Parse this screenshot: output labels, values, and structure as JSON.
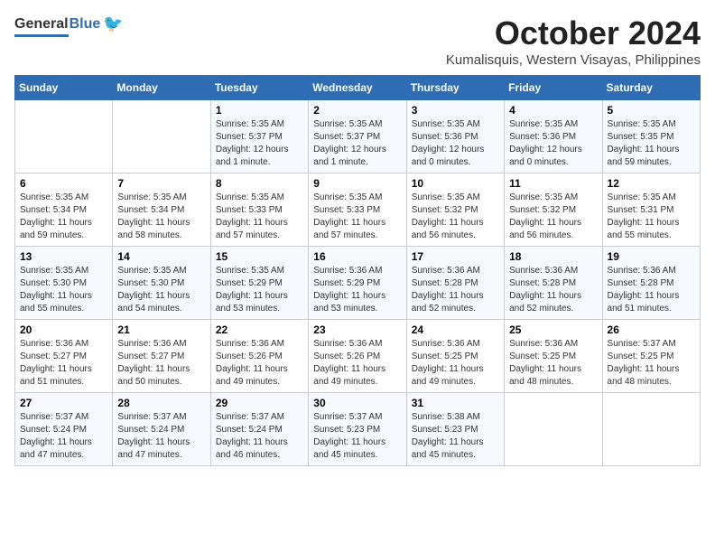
{
  "logo": {
    "general": "General",
    "blue": "Blue"
  },
  "title": {
    "month": "October 2024",
    "location": "Kumalisquis, Western Visayas, Philippines"
  },
  "headers": [
    "Sunday",
    "Monday",
    "Tuesday",
    "Wednesday",
    "Thursday",
    "Friday",
    "Saturday"
  ],
  "weeks": [
    [
      {
        "day": "",
        "sunrise": "",
        "sunset": "",
        "daylight": ""
      },
      {
        "day": "",
        "sunrise": "",
        "sunset": "",
        "daylight": ""
      },
      {
        "day": "1",
        "sunrise": "Sunrise: 5:35 AM",
        "sunset": "Sunset: 5:37 PM",
        "daylight": "Daylight: 12 hours and 1 minute."
      },
      {
        "day": "2",
        "sunrise": "Sunrise: 5:35 AM",
        "sunset": "Sunset: 5:37 PM",
        "daylight": "Daylight: 12 hours and 1 minute."
      },
      {
        "day": "3",
        "sunrise": "Sunrise: 5:35 AM",
        "sunset": "Sunset: 5:36 PM",
        "daylight": "Daylight: 12 hours and 0 minutes."
      },
      {
        "day": "4",
        "sunrise": "Sunrise: 5:35 AM",
        "sunset": "Sunset: 5:36 PM",
        "daylight": "Daylight: 12 hours and 0 minutes."
      },
      {
        "day": "5",
        "sunrise": "Sunrise: 5:35 AM",
        "sunset": "Sunset: 5:35 PM",
        "daylight": "Daylight: 11 hours and 59 minutes."
      }
    ],
    [
      {
        "day": "6",
        "sunrise": "Sunrise: 5:35 AM",
        "sunset": "Sunset: 5:34 PM",
        "daylight": "Daylight: 11 hours and 59 minutes."
      },
      {
        "day": "7",
        "sunrise": "Sunrise: 5:35 AM",
        "sunset": "Sunset: 5:34 PM",
        "daylight": "Daylight: 11 hours and 58 minutes."
      },
      {
        "day": "8",
        "sunrise": "Sunrise: 5:35 AM",
        "sunset": "Sunset: 5:33 PM",
        "daylight": "Daylight: 11 hours and 57 minutes."
      },
      {
        "day": "9",
        "sunrise": "Sunrise: 5:35 AM",
        "sunset": "Sunset: 5:33 PM",
        "daylight": "Daylight: 11 hours and 57 minutes."
      },
      {
        "day": "10",
        "sunrise": "Sunrise: 5:35 AM",
        "sunset": "Sunset: 5:32 PM",
        "daylight": "Daylight: 11 hours and 56 minutes."
      },
      {
        "day": "11",
        "sunrise": "Sunrise: 5:35 AM",
        "sunset": "Sunset: 5:32 PM",
        "daylight": "Daylight: 11 hours and 56 minutes."
      },
      {
        "day": "12",
        "sunrise": "Sunrise: 5:35 AM",
        "sunset": "Sunset: 5:31 PM",
        "daylight": "Daylight: 11 hours and 55 minutes."
      }
    ],
    [
      {
        "day": "13",
        "sunrise": "Sunrise: 5:35 AM",
        "sunset": "Sunset: 5:30 PM",
        "daylight": "Daylight: 11 hours and 55 minutes."
      },
      {
        "day": "14",
        "sunrise": "Sunrise: 5:35 AM",
        "sunset": "Sunset: 5:30 PM",
        "daylight": "Daylight: 11 hours and 54 minutes."
      },
      {
        "day": "15",
        "sunrise": "Sunrise: 5:35 AM",
        "sunset": "Sunset: 5:29 PM",
        "daylight": "Daylight: 11 hours and 53 minutes."
      },
      {
        "day": "16",
        "sunrise": "Sunrise: 5:36 AM",
        "sunset": "Sunset: 5:29 PM",
        "daylight": "Daylight: 11 hours and 53 minutes."
      },
      {
        "day": "17",
        "sunrise": "Sunrise: 5:36 AM",
        "sunset": "Sunset: 5:28 PM",
        "daylight": "Daylight: 11 hours and 52 minutes."
      },
      {
        "day": "18",
        "sunrise": "Sunrise: 5:36 AM",
        "sunset": "Sunset: 5:28 PM",
        "daylight": "Daylight: 11 hours and 52 minutes."
      },
      {
        "day": "19",
        "sunrise": "Sunrise: 5:36 AM",
        "sunset": "Sunset: 5:28 PM",
        "daylight": "Daylight: 11 hours and 51 minutes."
      }
    ],
    [
      {
        "day": "20",
        "sunrise": "Sunrise: 5:36 AM",
        "sunset": "Sunset: 5:27 PM",
        "daylight": "Daylight: 11 hours and 51 minutes."
      },
      {
        "day": "21",
        "sunrise": "Sunrise: 5:36 AM",
        "sunset": "Sunset: 5:27 PM",
        "daylight": "Daylight: 11 hours and 50 minutes."
      },
      {
        "day": "22",
        "sunrise": "Sunrise: 5:36 AM",
        "sunset": "Sunset: 5:26 PM",
        "daylight": "Daylight: 11 hours and 49 minutes."
      },
      {
        "day": "23",
        "sunrise": "Sunrise: 5:36 AM",
        "sunset": "Sunset: 5:26 PM",
        "daylight": "Daylight: 11 hours and 49 minutes."
      },
      {
        "day": "24",
        "sunrise": "Sunrise: 5:36 AM",
        "sunset": "Sunset: 5:25 PM",
        "daylight": "Daylight: 11 hours and 49 minutes."
      },
      {
        "day": "25",
        "sunrise": "Sunrise: 5:36 AM",
        "sunset": "Sunset: 5:25 PM",
        "daylight": "Daylight: 11 hours and 48 minutes."
      },
      {
        "day": "26",
        "sunrise": "Sunrise: 5:37 AM",
        "sunset": "Sunset: 5:25 PM",
        "daylight": "Daylight: 11 hours and 48 minutes."
      }
    ],
    [
      {
        "day": "27",
        "sunrise": "Sunrise: 5:37 AM",
        "sunset": "Sunset: 5:24 PM",
        "daylight": "Daylight: 11 hours and 47 minutes."
      },
      {
        "day": "28",
        "sunrise": "Sunrise: 5:37 AM",
        "sunset": "Sunset: 5:24 PM",
        "daylight": "Daylight: 11 hours and 47 minutes."
      },
      {
        "day": "29",
        "sunrise": "Sunrise: 5:37 AM",
        "sunset": "Sunset: 5:24 PM",
        "daylight": "Daylight: 11 hours and 46 minutes."
      },
      {
        "day": "30",
        "sunrise": "Sunrise: 5:37 AM",
        "sunset": "Sunset: 5:23 PM",
        "daylight": "Daylight: 11 hours and 45 minutes."
      },
      {
        "day": "31",
        "sunrise": "Sunrise: 5:38 AM",
        "sunset": "Sunset: 5:23 PM",
        "daylight": "Daylight: 11 hours and 45 minutes."
      },
      {
        "day": "",
        "sunrise": "",
        "sunset": "",
        "daylight": ""
      },
      {
        "day": "",
        "sunrise": "",
        "sunset": "",
        "daylight": ""
      }
    ]
  ]
}
